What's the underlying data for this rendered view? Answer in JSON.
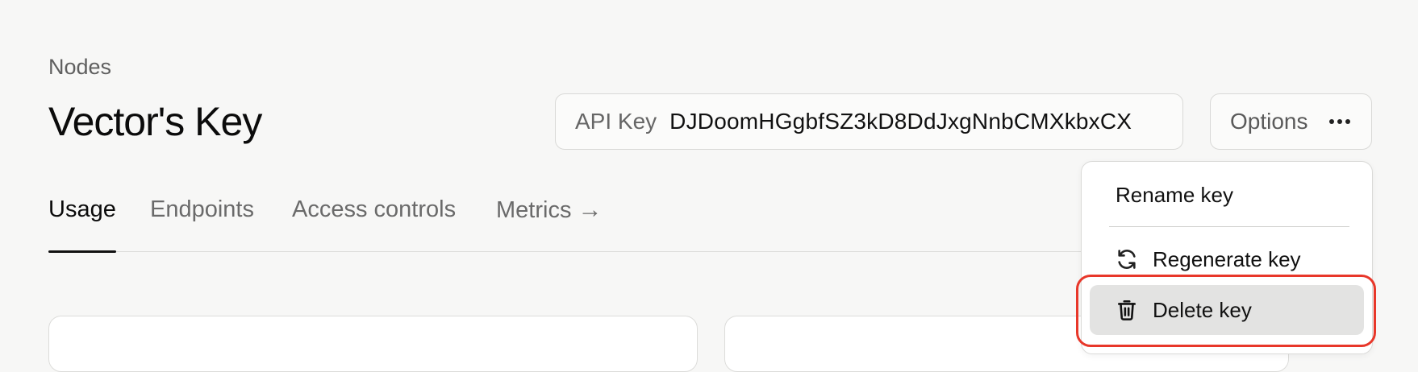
{
  "header": {
    "breadcrumb": "Nodes",
    "title": "Vector's Key"
  },
  "api_key": {
    "label": "API Key",
    "value": "DJDoomHGgbfSZ3kD8DdJxgNnbCMXkbxCX"
  },
  "options": {
    "label": "Options",
    "icon": "ellipsis-icon"
  },
  "tabs": [
    {
      "label": "Usage",
      "active": true
    },
    {
      "label": "Endpoints",
      "active": false
    },
    {
      "label": "Access controls",
      "active": false
    },
    {
      "label": "Metrics",
      "active": false,
      "icon": "arrow-right-icon"
    }
  ],
  "menu": {
    "items": [
      {
        "label": "Rename key"
      },
      {
        "label": "Regenerate key",
        "icon": "refresh-icon"
      },
      {
        "label": "Delete key",
        "icon": "trash-icon",
        "highlighted": true
      }
    ]
  },
  "colors": {
    "highlight_outline": "#e8372a",
    "background": "#f7f7f6"
  }
}
